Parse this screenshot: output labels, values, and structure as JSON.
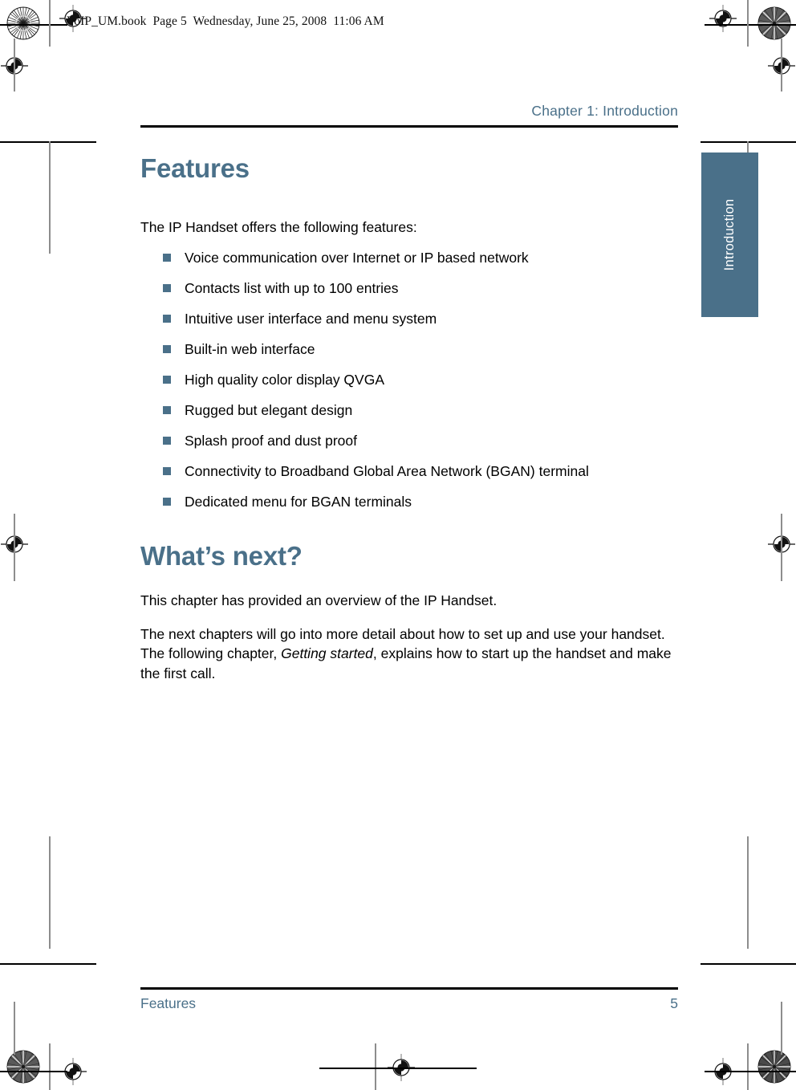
{
  "file_banner": "VoIP_UM.book  Page 5  Wednesday, June 25, 2008  11:06 AM",
  "running_header": {
    "chapter": "Chapter 1:  Introduction"
  },
  "thumb_tab": {
    "label": "Introduction",
    "color": "#4a7089"
  },
  "content": {
    "section_title": "Features",
    "intro_line": "The IP Handset offers the following features:",
    "features": [
      "Voice communication over Internet or IP based network",
      "Contacts list with up to 100 entries",
      "Intuitive user interface and menu system",
      "Built-in web interface",
      "High quality color display QVGA",
      "Rugged but elegant design",
      "Splash proof and dust proof",
      "Connectivity to Broadband Global Area Network (BGAN) terminal",
      "Dedicated menu for BGAN terminals"
    ],
    "next_title": "What’s next?",
    "paragraph_1": "This chapter has provided an overview of the IP Handset.",
    "paragraph_2_part1": "The next chapters will go into more detail about how to set up and use your handset. The following chapter, ",
    "paragraph_2_italic": "Getting started",
    "paragraph_2_part2": ", explains how to start up the handset and make the first call."
  },
  "footer": {
    "section": "Features",
    "page_number": "5"
  },
  "colors": {
    "accent": "#4a7089",
    "text": "#000000",
    "rule": "#000000"
  }
}
